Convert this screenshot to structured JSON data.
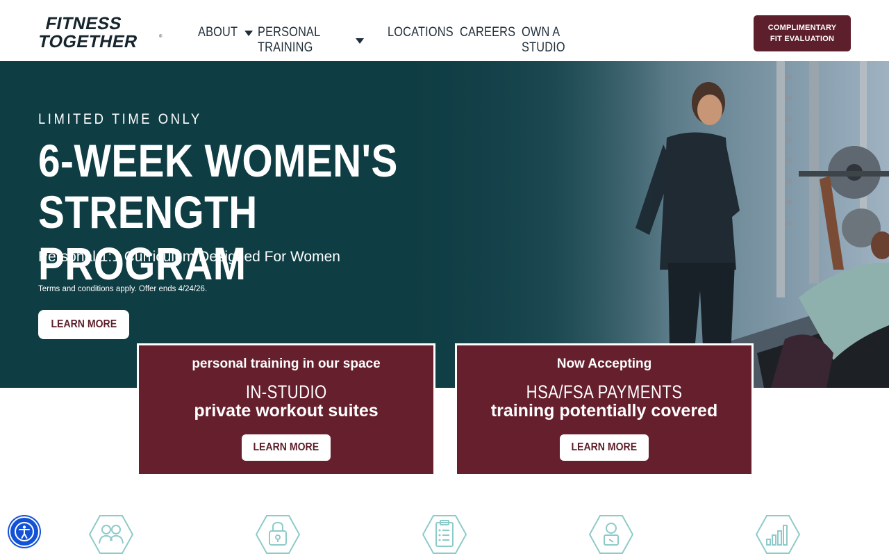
{
  "header": {
    "logo": {
      "line1": "FITNESS",
      "line2": "TOGETHER",
      "mark": "®"
    },
    "nav": [
      {
        "label": "ABOUT",
        "has_dropdown": true
      },
      {
        "label": "PERSONAL TRAINING",
        "has_dropdown": true
      },
      {
        "label": "LOCATIONS",
        "has_dropdown": false
      },
      {
        "label": "CAREERS",
        "has_dropdown": false
      },
      {
        "label": "OWN A STUDIO",
        "has_dropdown": false
      }
    ],
    "cta_label": "COMPLIMENTARY FIT EVALUATION"
  },
  "hero": {
    "eyebrow": "LIMITED TIME ONLY",
    "title_line1": "6-WEEK WOMEN'S",
    "title_line2": "STRENGTH PROGRAM",
    "subtitle": "Personal 1:1 Curriculum Designed For Women",
    "terms": "Terms and conditions apply. Offer ends 4/24/26.",
    "button_label": "LEARN MORE"
  },
  "cards": [
    {
      "eyebrow": "personal training in our space",
      "headline": "IN-STUDIO",
      "body": "private workout suites",
      "button_label": "LEARN MORE"
    },
    {
      "eyebrow": "Now Accepting",
      "headline": "HSA/FSA PAYMENTS",
      "body": "training potentially covered",
      "button_label": "LEARN MORE"
    }
  ],
  "features": {
    "icons": [
      "people-icon",
      "lock-icon",
      "clipboard-icon",
      "trainer-icon",
      "bar-chart-icon"
    ]
  },
  "colors": {
    "brand_maroon": "#651f2d",
    "hero_teal": "#0f3d44",
    "icon_teal": "#8ccbc9",
    "a11y_blue": "#1352d6"
  }
}
